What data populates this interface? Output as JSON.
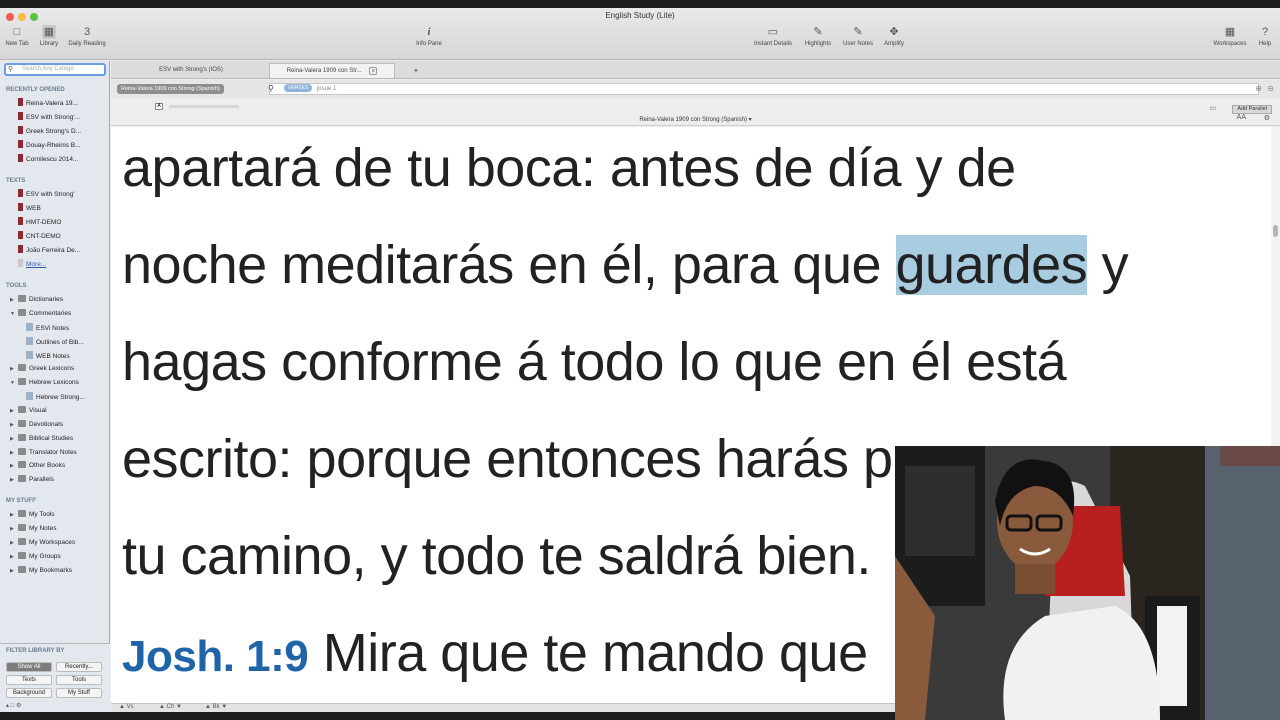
{
  "window": {
    "title": "English Study (Lite)"
  },
  "toolbar": {
    "new_tab": "New Tab",
    "library": "Library",
    "daily_reading": "Daily Reading",
    "info_pane": "Info Pane",
    "instant_details": "Instant Details",
    "highlights": "Highlights",
    "user_notes": "User Notes",
    "amplify": "Amplify",
    "workspaces": "Workspaces",
    "help": "Help"
  },
  "sidebar": {
    "search_placeholder": "Search Any Catego",
    "recently_opened_header": "RECENTLY OPENED",
    "recent": [
      "Reina-Valera 19...",
      "ESV with Strong'...",
      "Greek Strong's D...",
      "Douay-Rheims B...",
      "Cornilescu 2014..."
    ],
    "texts_header": "TEXTS",
    "texts": [
      "ESV with Strong'",
      "WEB",
      "HMT-DEMO",
      "CNT-DEMO",
      "João Ferreira De...",
      "More..."
    ],
    "tools_header": "TOOLS",
    "tools": {
      "dictionaries": "Dictionaries",
      "commentaries": "Commentaries",
      "commentary_items": [
        "ESVi Notes",
        "Outlines of Bib...",
        "WEB Notes"
      ],
      "greek_lexicons": "Greek Lexicons",
      "hebrew_lexicons": "Hebrew Lexicons",
      "hebrew_items": [
        "Hebrew Strong..."
      ],
      "visual": "Visual",
      "devotionals": "Devotionals",
      "biblical_studies": "Biblical Studies",
      "translator_notes": "Translator Notes",
      "other_books": "Other Books",
      "parallels": "Parallels"
    },
    "my_stuff_header": "MY STUFF",
    "my_stuff": [
      "My Tools",
      "My Notes",
      "My Workspaces",
      "My Groups",
      "My Bookmarks"
    ],
    "filter_header": "FILTER LIBRARY BY",
    "filter_buttons": [
      "Show All",
      "Recently...",
      "Texts",
      "Tools",
      "Background",
      "My Stuff"
    ]
  },
  "tabs": [
    {
      "label": "ESV with Strong's (IOS)"
    },
    {
      "label": "Reina-Valera 1909 con Str..."
    }
  ],
  "tab_add": "+",
  "tab_close": "x",
  "address": {
    "resource_chip": "Reina-Valera 1909 con Strong (Spanish)",
    "verses_chip": "VERSES",
    "query": "josue 1"
  },
  "resource_title": "Reina-Valera 1909 con Strong (Spanish) ▾",
  "add_parallel": "Add Parallel",
  "text_size_label": "AA",
  "reader": {
    "line1": "apartará de tu boca: antes de día y de",
    "line2_before": "noche meditarás en él, para que ",
    "line2_highlight": "guardes",
    "line2_after": " y",
    "line3": "hagas conforme á todo lo que en él está",
    "line4": "escrito: porque entonces harás prosperar",
    "line5": "tu camino, y todo te saldrá bien.",
    "verse_ref": "Josh. 1:9",
    "line6": " Mira que te mando que"
  },
  "bottom_bar": {
    "vs": "Vs",
    "ch": "Ch",
    "bk": "Bk"
  },
  "colors": {
    "highlight": "#a8cde0",
    "verse_ref": "#1f63a8"
  }
}
